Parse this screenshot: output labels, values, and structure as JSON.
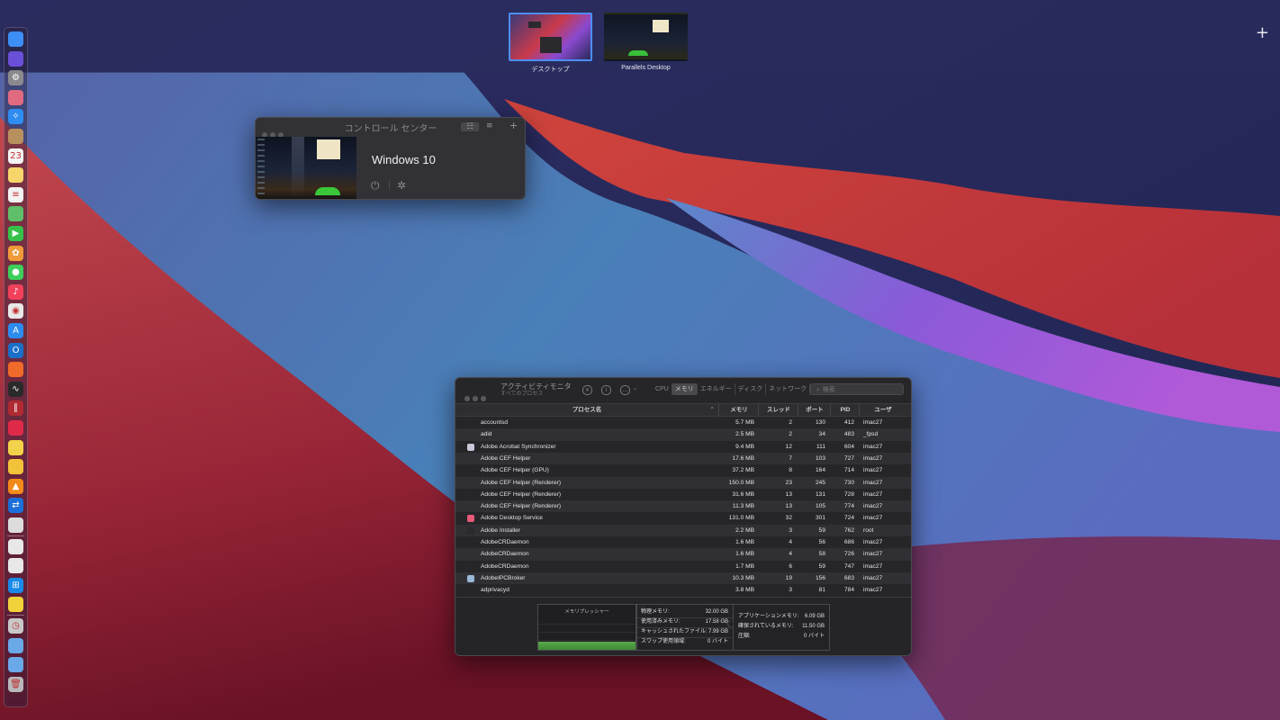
{
  "spaces": [
    {
      "label": "デスクトップ",
      "active": true
    },
    {
      "label": "Parallels Desktop",
      "active": false
    }
  ],
  "add_space_symbol": "+",
  "dock": {
    "items": [
      {
        "name": "finder-icon",
        "color": "#3d8ef5",
        "glyph": ""
      },
      {
        "name": "siri-icon",
        "color": "#6a4fd8",
        "glyph": ""
      },
      {
        "name": "system-preferences-icon",
        "color": "#8a8a8e",
        "glyph": "⚙"
      },
      {
        "name": "launchpad-icon",
        "color": "#e06a80",
        "glyph": ""
      },
      {
        "name": "safari-icon",
        "color": "#2f8cf0",
        "glyph": "✧"
      },
      {
        "name": "contacts-icon",
        "color": "#b8905e",
        "glyph": ""
      },
      {
        "name": "calendar-icon",
        "color": "#f4f4f4",
        "glyph": "23"
      },
      {
        "name": "notes-icon",
        "color": "#f6d66a",
        "glyph": ""
      },
      {
        "name": "reminders-icon",
        "color": "#f2f2f2",
        "glyph": "≡"
      },
      {
        "name": "maps-icon",
        "color": "#5fbf6a",
        "glyph": ""
      },
      {
        "name": "facetime-icon",
        "color": "#36c24a",
        "glyph": "▶"
      },
      {
        "name": "photos-icon",
        "color": "#f09a3a",
        "glyph": "✿"
      },
      {
        "name": "messages-icon",
        "color": "#3ccf5a",
        "glyph": "●"
      },
      {
        "name": "music-icon",
        "color": "#f0405a",
        "glyph": "♪"
      },
      {
        "name": "chrome-icon",
        "color": "#e8e8e8",
        "glyph": "◉"
      },
      {
        "name": "app-store-icon",
        "color": "#2d8cf0",
        "glyph": "A"
      },
      {
        "name": "outlook-icon",
        "color": "#1a6fc8",
        "glyph": "O"
      },
      {
        "name": "firefox-icon",
        "color": "#f06a2a",
        "glyph": ""
      },
      {
        "name": "activity-monitor-icon",
        "color": "#2a2a2a",
        "glyph": "∿"
      },
      {
        "name": "parallels-icon",
        "color": "#b02a32",
        "glyph": "∥"
      },
      {
        "name": "creative-cloud-icon",
        "color": "#e02a4a",
        "glyph": ""
      },
      {
        "name": "sticky-icon",
        "color": "#f2d24a",
        "glyph": ""
      },
      {
        "name": "cyberduck-icon",
        "color": "#f2c23a",
        "glyph": ""
      },
      {
        "name": "vlc-icon",
        "color": "#f28a1a",
        "glyph": "▲"
      },
      {
        "name": "teamviewer-icon",
        "color": "#1a6fd8",
        "glyph": "⇄"
      },
      {
        "name": "screen-sharing-icon",
        "color": "#dcdcdc",
        "glyph": ""
      },
      {
        "name": "preview-icon",
        "color": "#e8e8e8",
        "glyph": ""
      },
      {
        "name": "screenshot-icon",
        "color": "#e8e8e8",
        "glyph": ""
      },
      {
        "name": "windows-icon",
        "color": "#1a8ae8",
        "glyph": "⊞"
      },
      {
        "name": "stickies-icon",
        "color": "#f2d23a",
        "glyph": ""
      },
      {
        "name": "time-machine-icon",
        "color": "#c8c8c8",
        "glyph": "◷"
      },
      {
        "name": "downloads-folder-icon",
        "color": "#6aa8e8",
        "glyph": ""
      },
      {
        "name": "applications-folder-icon",
        "color": "#6aa8e8",
        "glyph": ""
      },
      {
        "name": "trash-icon",
        "color": "#b8b8bc",
        "glyph": "🗑"
      }
    ]
  },
  "control_center": {
    "title": "コントロール センター",
    "vm_name": "Windows 10"
  },
  "activity_monitor": {
    "title": "アクティビティモニタ",
    "subtitle": "すべてのプロセス",
    "tabs": [
      "CPU",
      "メモリ",
      "エネルギー",
      "ディスク",
      "ネットワーク"
    ],
    "selected_tab": "メモリ",
    "search_placeholder": "検索",
    "columns": [
      "プロセス名",
      "メモリ",
      "スレッド",
      "ポート",
      "PID",
      "ユーザ"
    ],
    "rows": [
      {
        "name": "accountsd",
        "mem": "5.7 MB",
        "threads": "2",
        "ports": "130",
        "pid": "412",
        "user": "imac27",
        "icon": ""
      },
      {
        "name": "adid",
        "mem": "2.5 MB",
        "threads": "2",
        "ports": "34",
        "pid": "483",
        "user": "_fpsd",
        "icon": ""
      },
      {
        "name": "Adobe Acrobat Synchronizer",
        "mem": "9.4 MB",
        "threads": "12",
        "ports": "111",
        "pid": "604",
        "user": "imac27",
        "icon": "#c8c8d8"
      },
      {
        "name": "Adobe CEF Helper",
        "mem": "17.6 MB",
        "threads": "7",
        "ports": "103",
        "pid": "727",
        "user": "imac27",
        "icon": ""
      },
      {
        "name": "Adobe CEF Helper (GPU)",
        "mem": "37.2 MB",
        "threads": "8",
        "ports": "164",
        "pid": "714",
        "user": "imac27",
        "icon": ""
      },
      {
        "name": "Adobe CEF Helper (Renderer)",
        "mem": "150.0 MB",
        "threads": "23",
        "ports": "245",
        "pid": "730",
        "user": "imac27",
        "icon": ""
      },
      {
        "name": "Adobe CEF Helper (Renderer)",
        "mem": "31.6 MB",
        "threads": "13",
        "ports": "131",
        "pid": "728",
        "user": "imac27",
        "icon": ""
      },
      {
        "name": "Adobe CEF Helper (Renderer)",
        "mem": "11.3 MB",
        "threads": "13",
        "ports": "105",
        "pid": "774",
        "user": "imac27",
        "icon": ""
      },
      {
        "name": "Adobe Desktop Service",
        "mem": "131.0 MB",
        "threads": "32",
        "ports": "301",
        "pid": "724",
        "user": "imac27",
        "icon": "#e85a7a"
      },
      {
        "name": "Adobe Installer",
        "mem": "2.2 MB",
        "threads": "3",
        "ports": "59",
        "pid": "762",
        "user": "root",
        "icon": "#2a2a2e"
      },
      {
        "name": "AdobeCRDaemon",
        "mem": "1.6 MB",
        "threads": "4",
        "ports": "56",
        "pid": "686",
        "user": "imac27",
        "icon": ""
      },
      {
        "name": "AdobeCRDaemon",
        "mem": "1.6 MB",
        "threads": "4",
        "ports": "58",
        "pid": "726",
        "user": "imac27",
        "icon": ""
      },
      {
        "name": "AdobeCRDaemon",
        "mem": "1.7 MB",
        "threads": "6",
        "ports": "59",
        "pid": "747",
        "user": "imac27",
        "icon": ""
      },
      {
        "name": "AdobeIPCBroker",
        "mem": "10.3 MB",
        "threads": "19",
        "ports": "156",
        "pid": "683",
        "user": "imac27",
        "icon": "#9ab8d8"
      },
      {
        "name": "adprivacyd",
        "mem": "3.8 MB",
        "threads": "3",
        "ports": "81",
        "pid": "784",
        "user": "imac27",
        "icon": ""
      }
    ],
    "memory_pressure_label": "メモリプレッシャー",
    "memory_pressure_level": 0.25,
    "stats_left": [
      {
        "label": "物理メモリ:",
        "value": "32.00 GB"
      },
      {
        "label": "使用済みメモリ:",
        "value": "17.58 GB"
      },
      {
        "label": "キャッシュされたファイル:",
        "value": "7.99 GB"
      },
      {
        "label": "スワップ使用領域:",
        "value": "0 バイト"
      }
    ],
    "stats_right": [
      {
        "label": "アプリケーションメモリ:",
        "value": "6.09 GB"
      },
      {
        "label": "確保されているメモリ:",
        "value": "11.50 GB"
      },
      {
        "label": "圧縮:",
        "value": "0 バイト"
      }
    ]
  }
}
